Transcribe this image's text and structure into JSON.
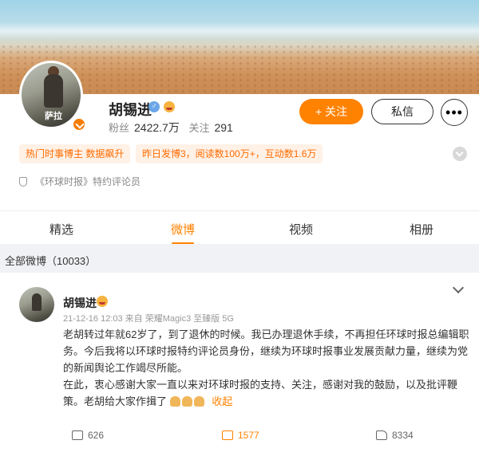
{
  "profile": {
    "name": "胡锡进",
    "gender_symbol": "♂",
    "avatar_caption": "萨拉",
    "stats": {
      "followers_label": "粉丝",
      "followers_value": "2422.7万",
      "following_label": "关注",
      "following_value": "291"
    },
    "follow_label": "+ 关注",
    "message_label": "私信",
    "more_label": "•••",
    "tags": [
      "热门时事博主 数据飙升",
      "昨日发博3，阅读数100万+，互动数1.6万"
    ],
    "certification": "《环球时报》特约评论员",
    "accent_color": "#ff8200"
  },
  "tabs": [
    "精选",
    "微博",
    "视频",
    "相册"
  ],
  "active_tab": "微博",
  "all_weibo_label": "全部微博（10033）",
  "post": {
    "author": "胡锡进",
    "meta": "21-12-16 12:03  来自 荣耀Magic3 至臻版 5G",
    "text_line1": "老胡转过年就62岁了，到了退休的时候。我已办理退休手续，不再担任环球时报总编辑职务。今后我将以环球时报特约评论员身份，继续为环球时报事业发展贡献力量，继续为党的新闻舆论工作竭尽所能。",
    "text_line2": "在此，衷心感谢大家一直以来对环球时报的支持、关注，感谢对我的鼓励，以及批评鞭策。老胡给大家作揖了",
    "collapse_label": "收起",
    "repost_count": "626",
    "comment_count": "1577",
    "like_count": "8334"
  }
}
